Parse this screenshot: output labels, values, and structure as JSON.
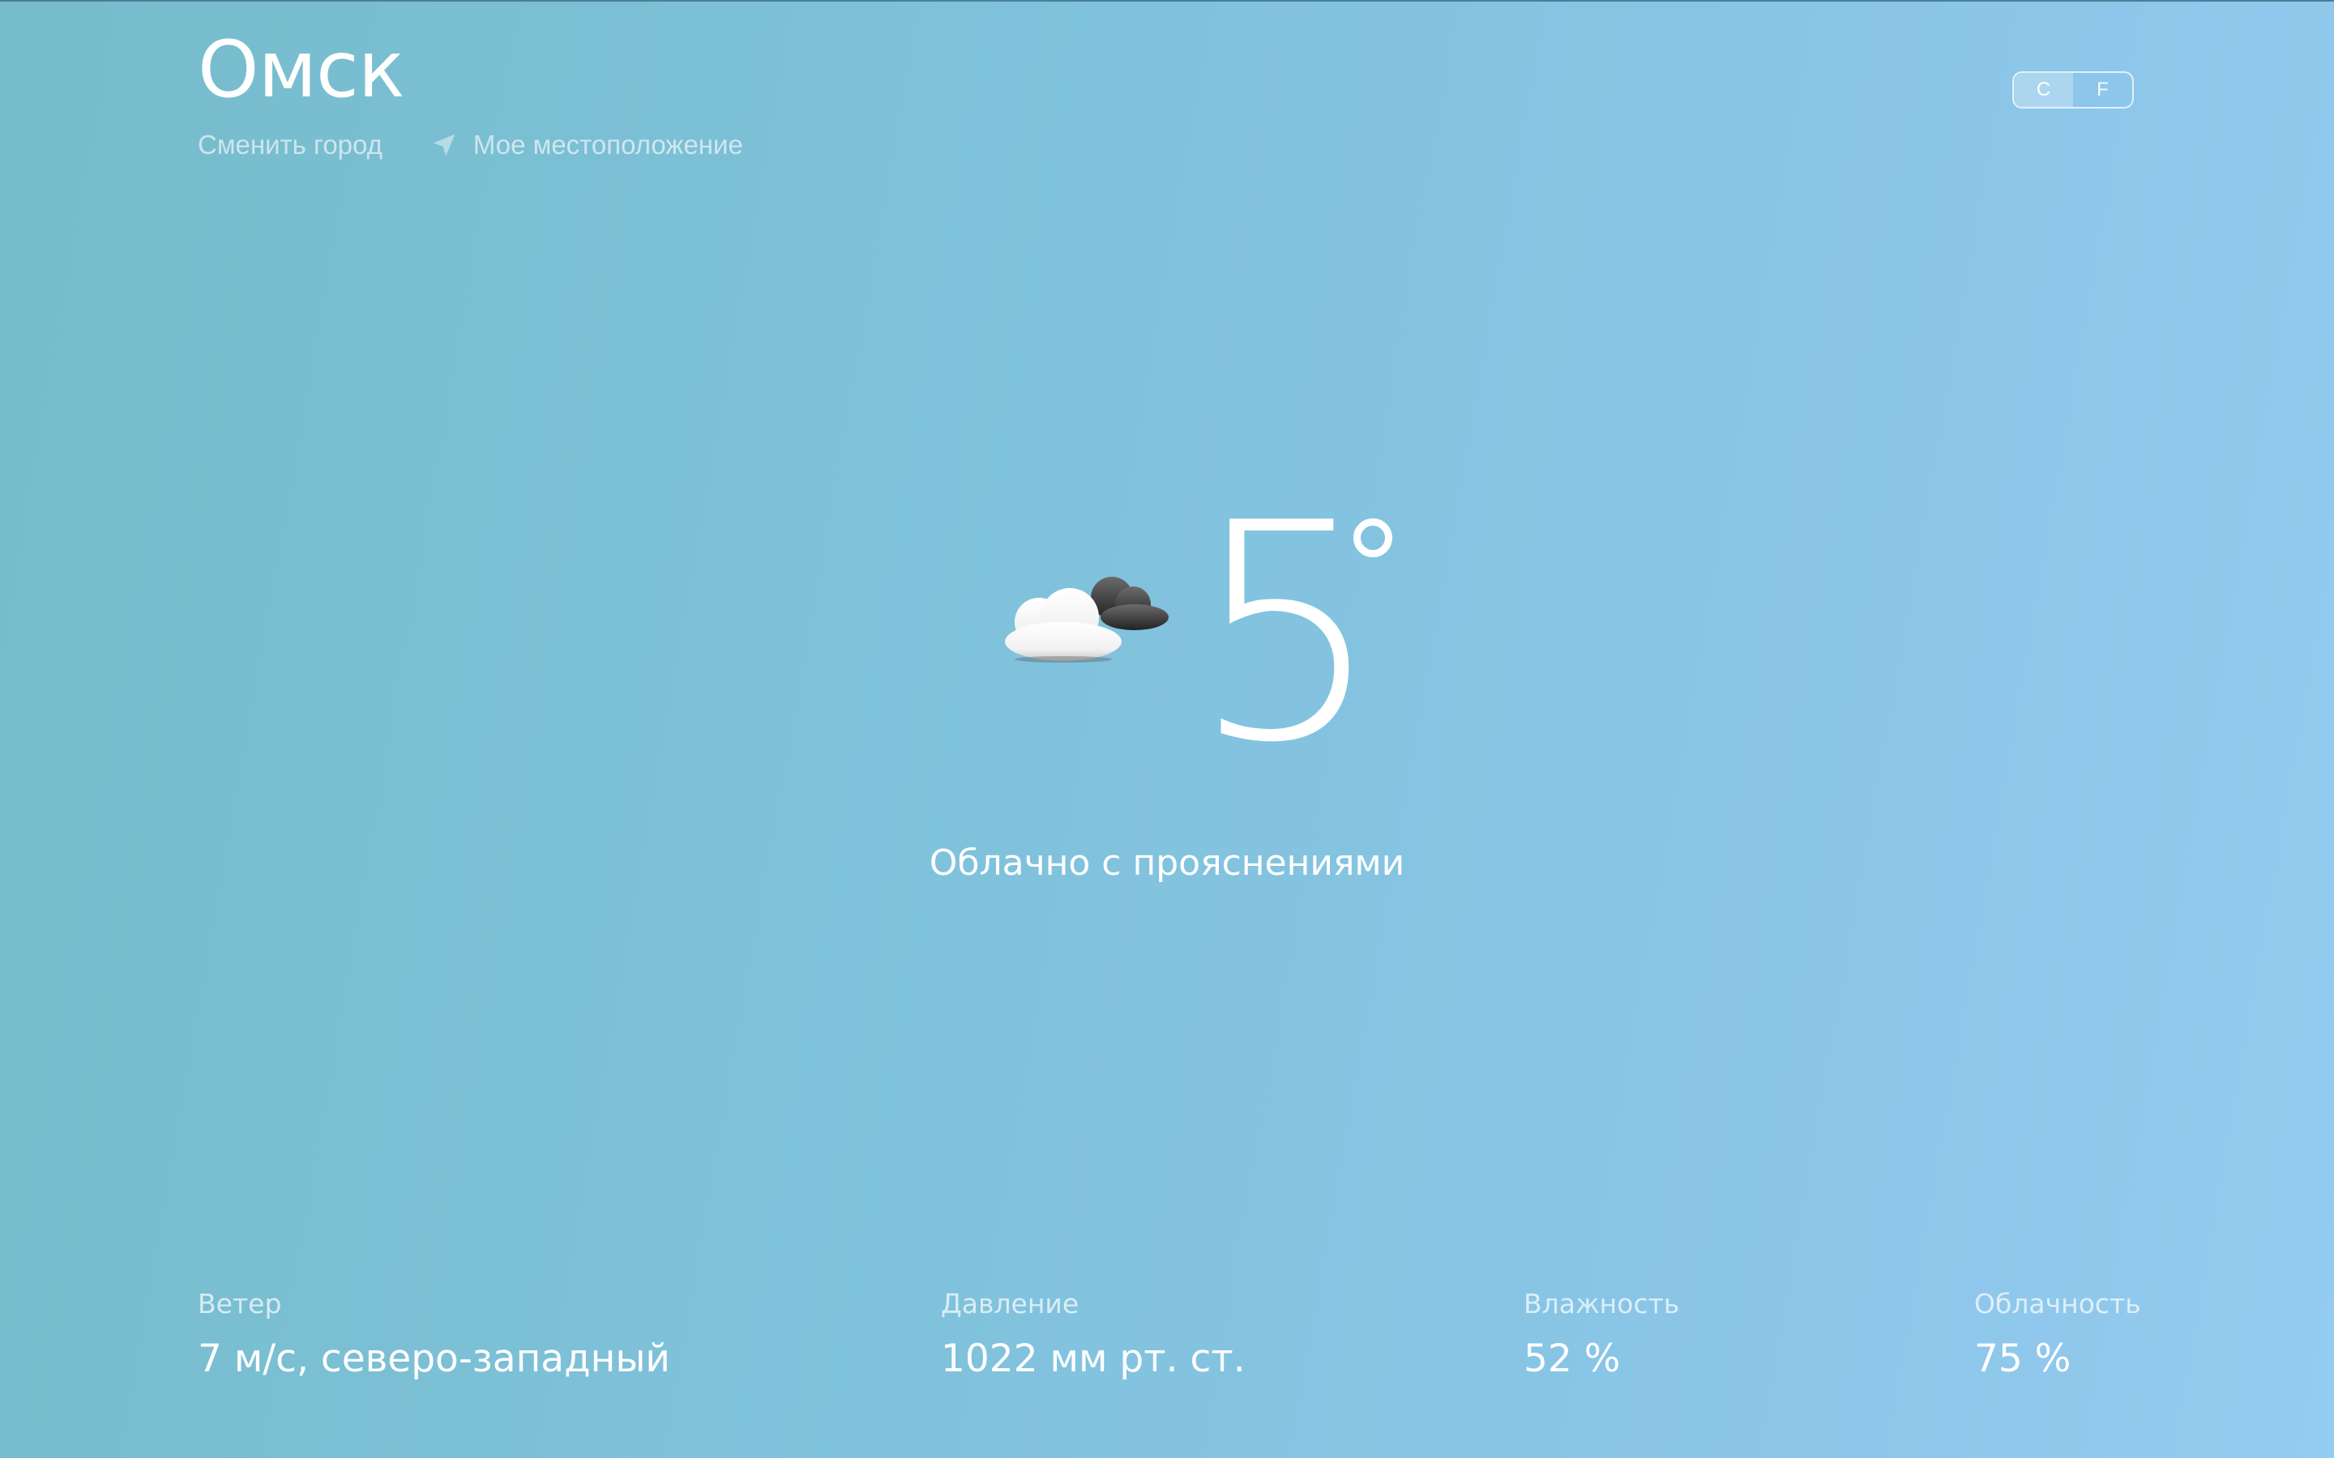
{
  "header": {
    "city": "Омск",
    "change_city_label": "Сменить город",
    "my_location_label": "Мое местоположение",
    "location_icon": "location-arrow-icon"
  },
  "units": {
    "celsius_label": "C",
    "fahrenheit_label": "F",
    "selected": "C"
  },
  "current": {
    "icon": "partly-cloudy-icon",
    "temperature": "5",
    "condition": "Облачно с прояснениями"
  },
  "stats": [
    {
      "label": "Ветер",
      "value": "7 м/с, северо-западный"
    },
    {
      "label": "Давление",
      "value": "1022 мм рт. ст."
    },
    {
      "label": "Влажность",
      "value": "52 %"
    },
    {
      "label": "Облачность",
      "value": "75 %"
    }
  ],
  "colors": {
    "background_start": "#76bccb",
    "background_end": "#94cbf0",
    "text": "#ffffff"
  }
}
